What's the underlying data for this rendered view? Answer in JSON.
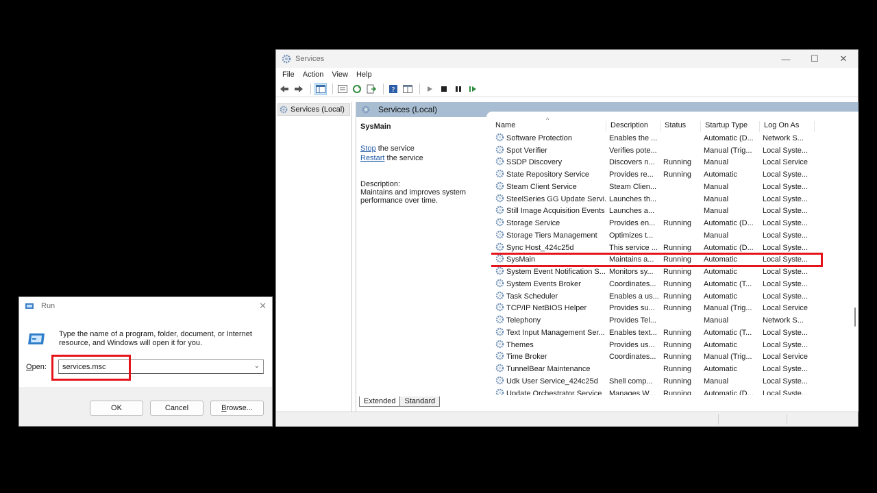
{
  "services_window": {
    "title": "Services",
    "controls": {
      "minimize": "—",
      "maximize": "☐",
      "close": "✕"
    },
    "menu": [
      "File",
      "Action",
      "View",
      "Help"
    ],
    "tree_item": "Services (Local)",
    "pane_header": "Services (Local)",
    "selected_service": {
      "name": "SysMain",
      "stop_link": "Stop",
      "stop_rest": " the service",
      "restart_link": "Restart",
      "restart_rest": " the service",
      "description_label": "Description:",
      "description": "Maintains and improves system performance over time."
    },
    "columns": [
      "Name",
      "Description",
      "Status",
      "Startup Type",
      "Log On As"
    ],
    "rows": [
      {
        "name": "Software Protection",
        "desc": "Enables the ...",
        "status": "",
        "startup": "Automatic (D...",
        "logon": "Network S..."
      },
      {
        "name": "Spot Verifier",
        "desc": "Verifies pote...",
        "status": "",
        "startup": "Manual (Trig...",
        "logon": "Local Syste..."
      },
      {
        "name": "SSDP Discovery",
        "desc": "Discovers n...",
        "status": "Running",
        "startup": "Manual",
        "logon": "Local Service"
      },
      {
        "name": "State Repository Service",
        "desc": "Provides re...",
        "status": "Running",
        "startup": "Automatic",
        "logon": "Local Syste..."
      },
      {
        "name": "Steam Client Service",
        "desc": "Steam Clien...",
        "status": "",
        "startup": "Manual",
        "logon": "Local Syste..."
      },
      {
        "name": "SteelSeries GG Update Servi...",
        "desc": "Launches th...",
        "status": "",
        "startup": "Manual",
        "logon": "Local Syste..."
      },
      {
        "name": "Still Image Acquisition Events",
        "desc": "Launches a...",
        "status": "",
        "startup": "Manual",
        "logon": "Local Syste..."
      },
      {
        "name": "Storage Service",
        "desc": "Provides en...",
        "status": "Running",
        "startup": "Automatic (D...",
        "logon": "Local Syste..."
      },
      {
        "name": "Storage Tiers Management",
        "desc": "Optimizes t...",
        "status": "",
        "startup": "Manual",
        "logon": "Local Syste..."
      },
      {
        "name": "Sync Host_424c25d",
        "desc": "This service ...",
        "status": "Running",
        "startup": "Automatic (D...",
        "logon": "Local Syste..."
      },
      {
        "name": "SysMain",
        "desc": "Maintains a...",
        "status": "Running",
        "startup": "Automatic",
        "logon": "Local Syste..."
      },
      {
        "name": "System Event Notification S...",
        "desc": "Monitors sy...",
        "status": "Running",
        "startup": "Automatic",
        "logon": "Local Syste..."
      },
      {
        "name": "System Events Broker",
        "desc": "Coordinates...",
        "status": "Running",
        "startup": "Automatic (T...",
        "logon": "Local Syste..."
      },
      {
        "name": "Task Scheduler",
        "desc": "Enables a us...",
        "status": "Running",
        "startup": "Automatic",
        "logon": "Local Syste..."
      },
      {
        "name": "TCP/IP NetBIOS Helper",
        "desc": "Provides su...",
        "status": "Running",
        "startup": "Manual (Trig...",
        "logon": "Local Service"
      },
      {
        "name": "Telephony",
        "desc": "Provides Tel...",
        "status": "",
        "startup": "Manual",
        "logon": "Network S..."
      },
      {
        "name": "Text Input Management Ser...",
        "desc": "Enables text...",
        "status": "Running",
        "startup": "Automatic (T...",
        "logon": "Local Syste..."
      },
      {
        "name": "Themes",
        "desc": "Provides us...",
        "status": "Running",
        "startup": "Automatic",
        "logon": "Local Syste..."
      },
      {
        "name": "Time Broker",
        "desc": "Coordinates...",
        "status": "Running",
        "startup": "Manual (Trig...",
        "logon": "Local Service"
      },
      {
        "name": "TunnelBear Maintenance",
        "desc": "",
        "status": "Running",
        "startup": "Automatic",
        "logon": "Local Syste..."
      },
      {
        "name": "Udk User Service_424c25d",
        "desc": "Shell comp...",
        "status": "Running",
        "startup": "Manual",
        "logon": "Local Syste..."
      },
      {
        "name": "Update Orchestrator Service",
        "desc": "Manages W...",
        "status": "Running",
        "startup": "Automatic (D...",
        "logon": "Local Syste..."
      }
    ],
    "highlighted_row": 10,
    "tabs": [
      "Extended",
      "Standard"
    ]
  },
  "run_dialog": {
    "title": "Run",
    "close": "✕",
    "prompt": "Type the name of a program, folder, document, or Internet resource, and Windows will open it for you.",
    "open_label_underlined": "O",
    "open_label_rest": "pen:",
    "open_value": "services.msc",
    "buttons": {
      "ok": "OK",
      "cancel": "Cancel",
      "browse_underlined": "B",
      "browse_rest": "rowse..."
    }
  },
  "colors": {
    "highlight": "#e5141b",
    "pane_header": "#a8bdd1",
    "link": "#1f5aa6"
  }
}
